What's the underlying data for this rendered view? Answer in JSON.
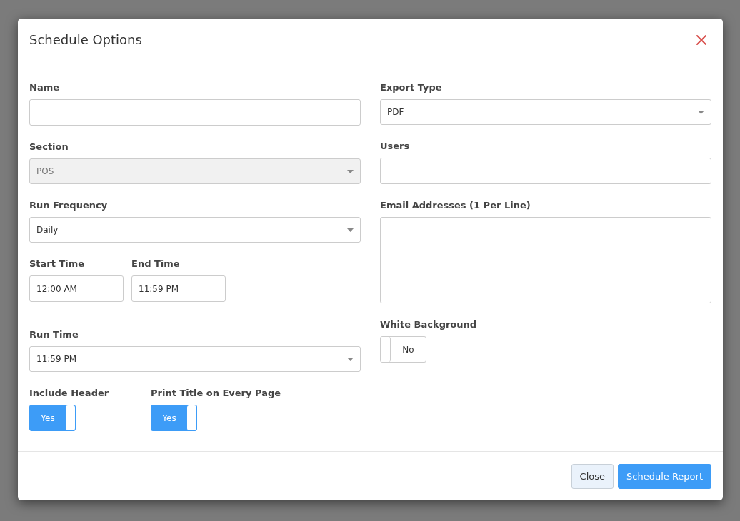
{
  "dialog": {
    "title": "Schedule Options"
  },
  "left_column": [
    {
      "kind": "text",
      "label": "Name"
    },
    {
      "kind": "select",
      "label": "Section",
      "value": "POS",
      "disabled": true
    },
    {
      "kind": "select",
      "label": "Run Frequency",
      "value": "Daily",
      "disabled": false
    },
    {
      "kind": "time_pair",
      "items": [
        {
          "label": "Start Time",
          "value": "12:00 AM"
        },
        {
          "label": "End Time",
          "value": "11:59 PM"
        }
      ]
    },
    {
      "kind": "select",
      "label": "Run Time",
      "value": "11:59 PM",
      "disabled": false
    },
    {
      "kind": "toggle_pair",
      "items": [
        {
          "label": "Include Header",
          "text": "Yes",
          "on": true
        },
        {
          "label": "Print Title on Every Page",
          "text": "Yes",
          "on": true
        }
      ]
    }
  ],
  "right_column": [
    {
      "kind": "select",
      "label": "Export Type",
      "value": "PDF",
      "disabled": false
    },
    {
      "kind": "text",
      "label": "Users"
    },
    {
      "kind": "textarea",
      "label": "Email Addresses (1 Per Line)"
    },
    {
      "kind": "toggle",
      "label": "White Background",
      "text": "No",
      "on": false
    }
  ],
  "buttons": [
    {
      "label": "Close",
      "kind": "secondary"
    },
    {
      "label": "Schedule Report",
      "kind": "primary"
    }
  ]
}
